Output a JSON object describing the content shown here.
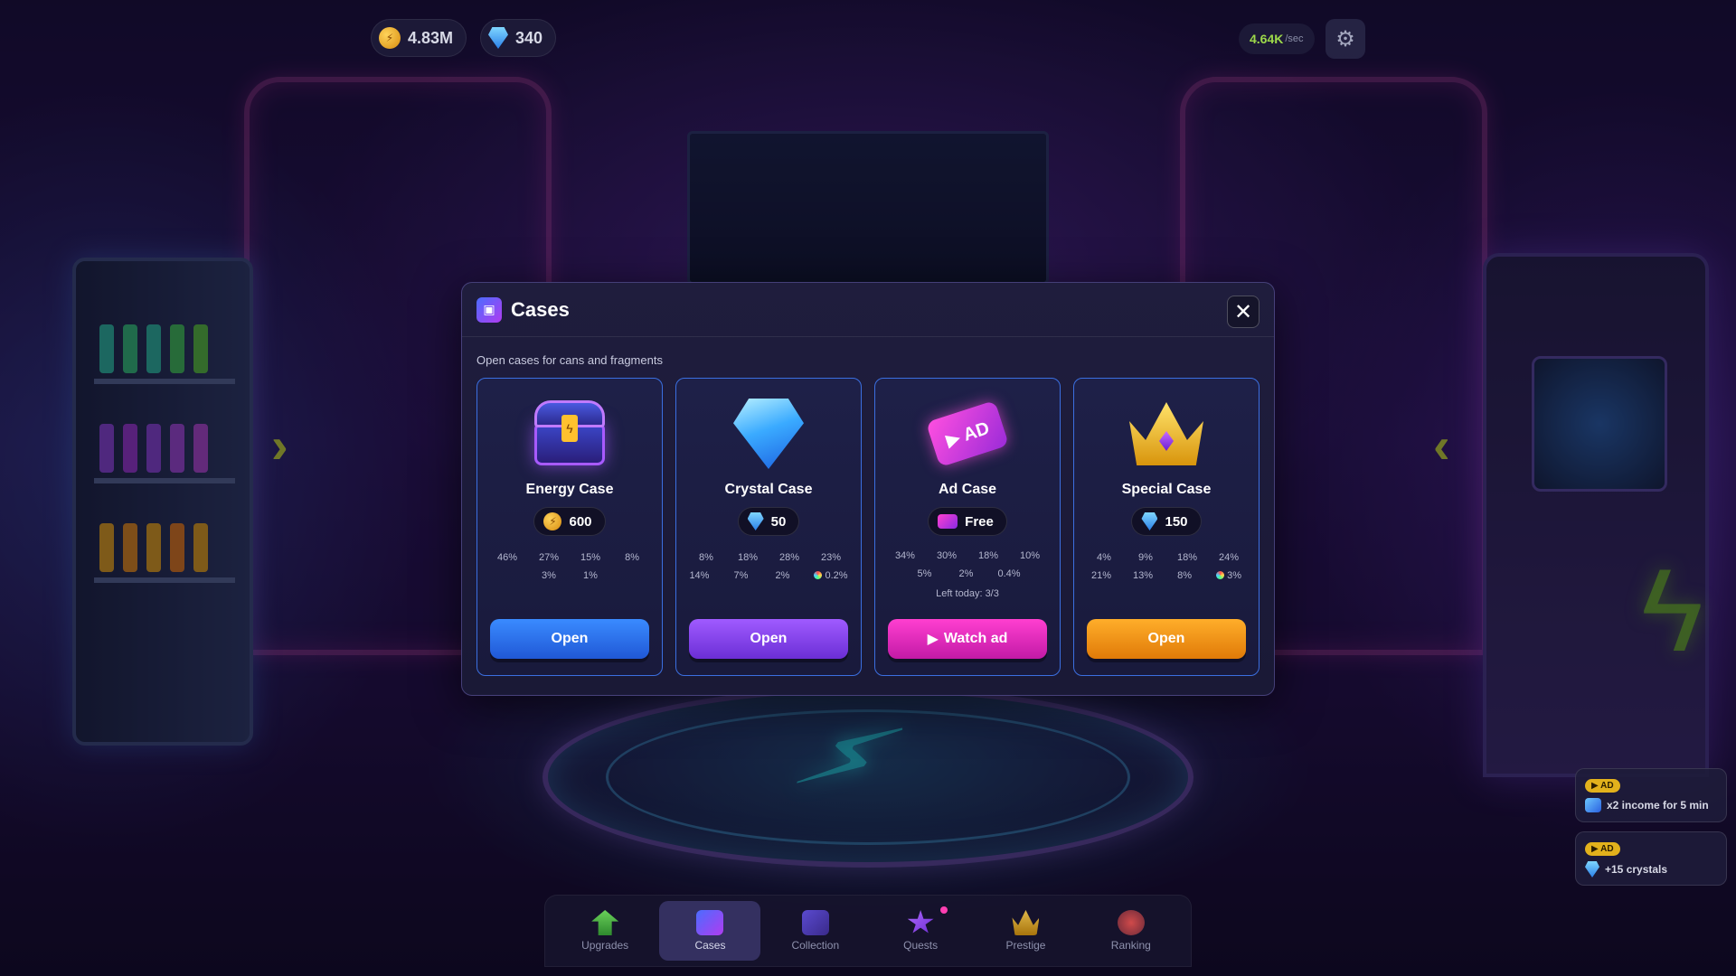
{
  "topbar": {
    "coins": "4.83M",
    "crystals": "340",
    "income_value": "4.64K",
    "income_unit": "/sec"
  },
  "modal": {
    "title": "Cases",
    "subtitle": "Open cases for cans and fragments",
    "close_label": "✕"
  },
  "cases": [
    {
      "name": "Energy Case",
      "icon": "chest-icon",
      "price_icon": "coin-icon",
      "price": "600",
      "odds_row1": [
        "46%",
        "27%",
        "15%",
        "8%"
      ],
      "odds_row2": [
        "3%",
        "1%"
      ],
      "button": "Open",
      "button_color": "#2f6ef0"
    },
    {
      "name": "Crystal Case",
      "icon": "diamond-icon",
      "price_icon": "crystal-icon",
      "price": "50",
      "odds_row1": [
        "8%",
        "18%",
        "28%",
        "23%"
      ],
      "odds_row2": [
        "14%",
        "7%",
        "2%",
        "0.2%"
      ],
      "button": "Open",
      "button_color": "#8a44f0"
    },
    {
      "name": "Ad Case",
      "icon": "ad-ticket-icon",
      "price_icon": "ad-icon",
      "price": "Free",
      "odds_row1": [
        "34%",
        "30%",
        "18%",
        "10%"
      ],
      "odds_row2": [
        "5%",
        "2%",
        "0.4%"
      ],
      "left_today": "Left today: 3/3",
      "button": "Watch ad",
      "button_color": "#e92ec0"
    },
    {
      "name": "Special Case",
      "icon": "crown-icon",
      "price_icon": "crystal-icon",
      "price": "150",
      "odds_row1": [
        "4%",
        "9%",
        "18%",
        "24%"
      ],
      "odds_row2": [
        "21%",
        "13%",
        "8%",
        "3%"
      ],
      "button": "Open",
      "button_color": "#f59a1b"
    }
  ],
  "offers": [
    {
      "tag": "▶ AD",
      "text": "x2 income for 5 min"
    },
    {
      "tag": "▶ AD",
      "text": "+15 crystals"
    }
  ],
  "nav": [
    {
      "label": "Upgrades",
      "icon": "upgrades-icon"
    },
    {
      "label": "Cases",
      "icon": "cases-icon",
      "active": true
    },
    {
      "label": "Collection",
      "icon": "collection-icon"
    },
    {
      "label": "Quests",
      "icon": "quests-icon",
      "badge": true
    },
    {
      "label": "Prestige",
      "icon": "prestige-icon"
    },
    {
      "label": "Ranking",
      "icon": "ranking-icon"
    }
  ]
}
